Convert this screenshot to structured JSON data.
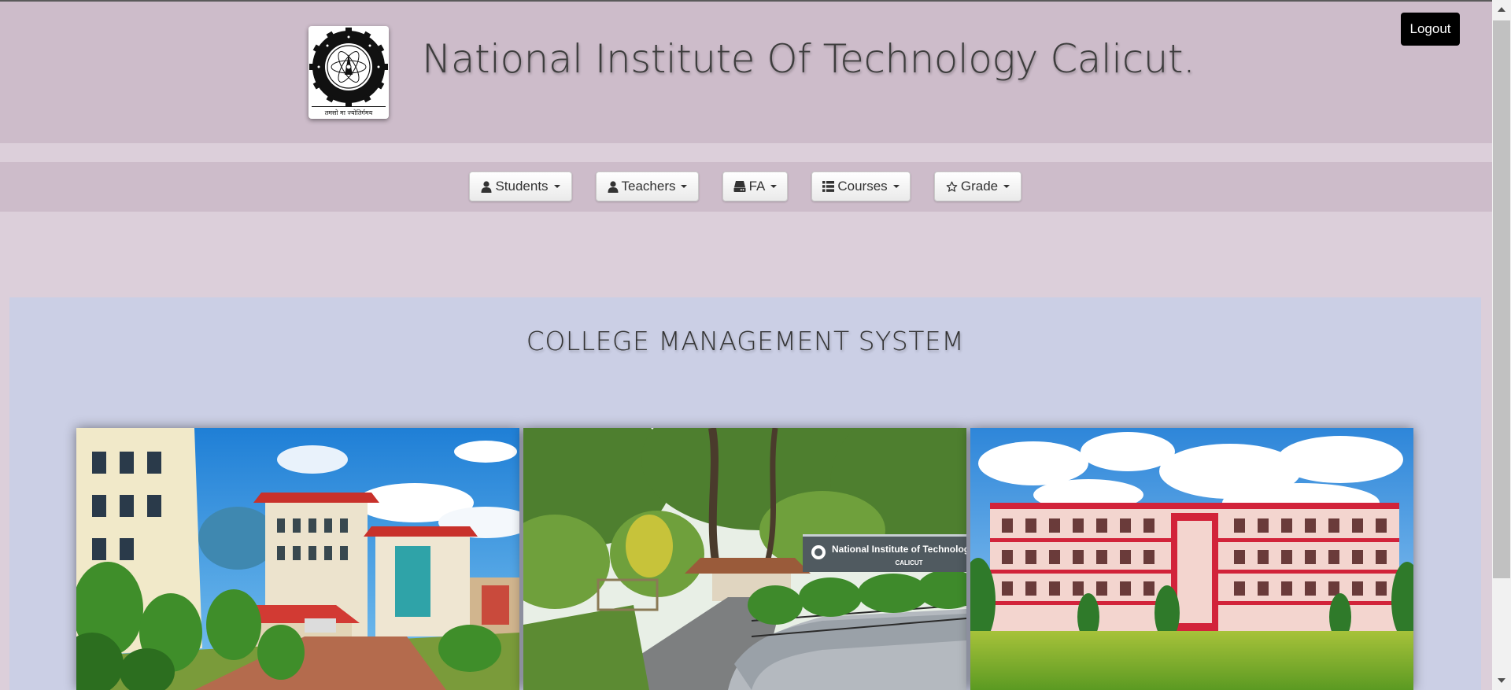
{
  "header": {
    "title": "National Institute Of Technology Calicut.",
    "logo_motto": "तमसो मा ज्योतिर्गमय",
    "logo_text": "NATIONAL INSTITUTE OF TECHNOLOGY CALICUT",
    "logout_label": "Logout"
  },
  "nav": {
    "items": [
      {
        "label": "Students",
        "icon": "user-icon"
      },
      {
        "label": "Teachers",
        "icon": "user-icon"
      },
      {
        "label": "FA",
        "icon": "hdd-icon"
      },
      {
        "label": "Courses",
        "icon": "list-icon"
      },
      {
        "label": "Grade",
        "icon": "star-icon"
      }
    ]
  },
  "main": {
    "heading": "COLLEGE MANAGEMENT SYSTEM",
    "photos": [
      {
        "name": "campus-building-photo-1"
      },
      {
        "name": "campus-entrance-photo",
        "sign_title": "National Institute of Technology",
        "sign_subtitle": "CALICUT"
      },
      {
        "name": "campus-building-photo-2"
      }
    ]
  },
  "colors": {
    "header_bg": "#cdbcca",
    "page_bg": "#dccfda",
    "panel_bg": "#cbcfe5",
    "logout_bg": "#000000"
  }
}
